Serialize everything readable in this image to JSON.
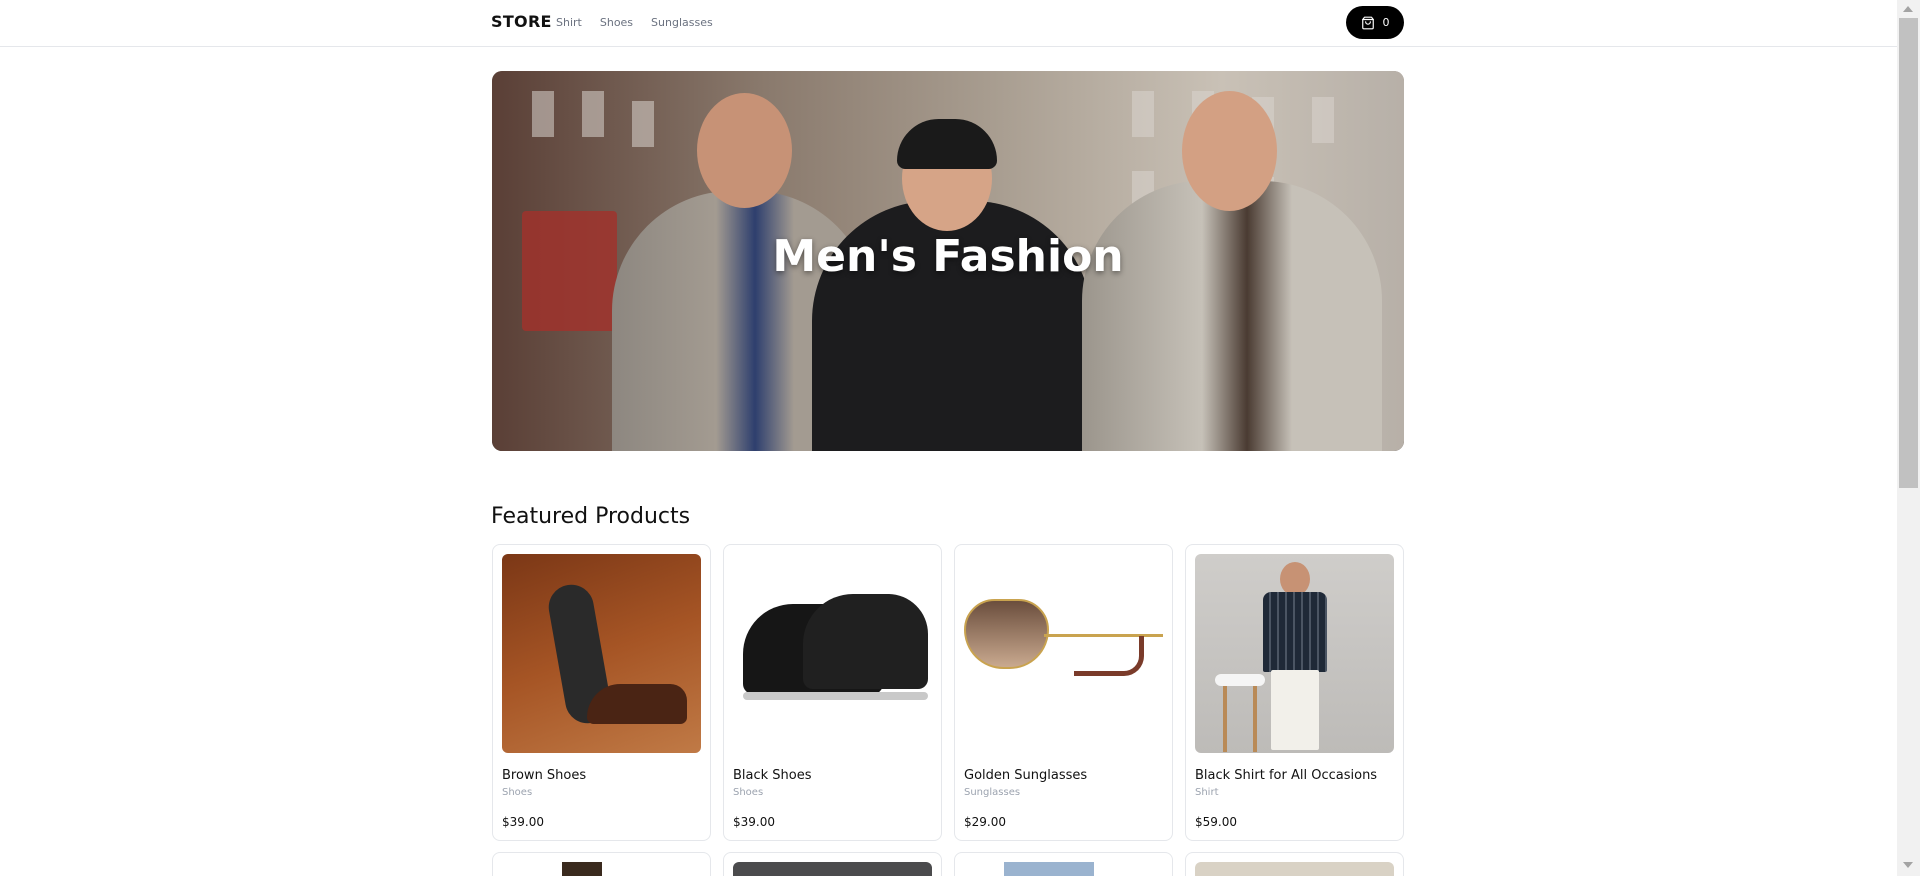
{
  "nav": {
    "brand": "STORE",
    "links": [
      "Shirt",
      "Shoes",
      "Sunglasses"
    ],
    "cart_count": "0"
  },
  "hero": {
    "title": "Men's Fashion"
  },
  "featured": {
    "title": "Featured Products",
    "products": [
      {
        "name": "Brown Shoes",
        "category": "Shoes",
        "price": "$39.00"
      },
      {
        "name": "Black Shoes",
        "category": "Shoes",
        "price": "$39.00"
      },
      {
        "name": "Golden Sunglasses",
        "category": "Sunglasses",
        "price": "$29.00"
      },
      {
        "name": "Black Shirt for All Occasions",
        "category": "Shirt",
        "price": "$59.00"
      }
    ]
  },
  "icons": {
    "cart": "shopping-bag-icon"
  }
}
